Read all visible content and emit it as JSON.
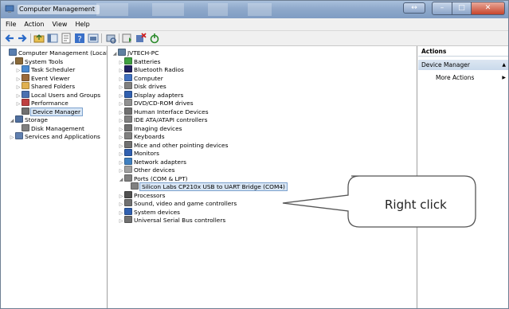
{
  "window": {
    "title": "Computer Management"
  },
  "menu": [
    "File",
    "Action",
    "View",
    "Help"
  ],
  "left_tree": [
    {
      "label": "Computer Management (Local",
      "indent": 0,
      "exp": "",
      "icon": "computer-management-icon",
      "color": "#5a7fb0"
    },
    {
      "label": "System Tools",
      "indent": 1,
      "exp": "◢",
      "icon": "tools-icon",
      "color": "#8a6a3a"
    },
    {
      "label": "Task Scheduler",
      "indent": 2,
      "exp": "▷",
      "icon": "clock-icon",
      "color": "#4a8ad0"
    },
    {
      "label": "Event Viewer",
      "indent": 2,
      "exp": "▷",
      "icon": "event-icon",
      "color": "#9a6a3a"
    },
    {
      "label": "Shared Folders",
      "indent": 2,
      "exp": "▷",
      "icon": "folder-icon",
      "color": "#e0b050"
    },
    {
      "label": "Local Users and Groups",
      "indent": 2,
      "exp": "▷",
      "icon": "users-icon",
      "color": "#4a70b0"
    },
    {
      "label": "Performance",
      "indent": 2,
      "exp": "▷",
      "icon": "performance-icon",
      "color": "#c04040"
    },
    {
      "label": "Device Manager",
      "indent": 2,
      "exp": "",
      "icon": "device-manager-icon",
      "color": "#707070",
      "selected": true
    },
    {
      "label": "Storage",
      "indent": 1,
      "exp": "◢",
      "icon": "storage-icon",
      "color": "#5070a0"
    },
    {
      "label": "Disk Management",
      "indent": 2,
      "exp": "",
      "icon": "disk-icon",
      "color": "#808080"
    },
    {
      "label": "Services and Applications",
      "indent": 1,
      "exp": "▷",
      "icon": "services-icon",
      "color": "#6080b0"
    }
  ],
  "device_tree": [
    {
      "label": "JVTECH-PC",
      "indent": 0,
      "exp": "◢",
      "icon": "pc-icon",
      "color": "#6080a0"
    },
    {
      "label": "Batteries",
      "indent": 1,
      "exp": "▷",
      "icon": "battery-icon",
      "color": "#40a040"
    },
    {
      "label": "Bluetooth Radios",
      "indent": 1,
      "exp": "▷",
      "icon": "bluetooth-icon",
      "color": "#202060"
    },
    {
      "label": "Computer",
      "indent": 1,
      "exp": "▷",
      "icon": "computer-icon",
      "color": "#4070c0"
    },
    {
      "label": "Disk drives",
      "indent": 1,
      "exp": "▷",
      "icon": "disk-drive-icon",
      "color": "#808080"
    },
    {
      "label": "Display adapters",
      "indent": 1,
      "exp": "▷",
      "icon": "display-icon",
      "color": "#3060b0"
    },
    {
      "label": "DVD/CD-ROM drives",
      "indent": 1,
      "exp": "▷",
      "icon": "dvd-icon",
      "color": "#909090"
    },
    {
      "label": "Human Interface Devices",
      "indent": 1,
      "exp": "▷",
      "icon": "hid-icon",
      "color": "#707070"
    },
    {
      "label": "IDE ATA/ATAPI controllers",
      "indent": 1,
      "exp": "▷",
      "icon": "ide-icon",
      "color": "#808080"
    },
    {
      "label": "Imaging devices",
      "indent": 1,
      "exp": "▷",
      "icon": "camera-icon",
      "color": "#707070"
    },
    {
      "label": "Keyboards",
      "indent": 1,
      "exp": "▷",
      "icon": "keyboard-icon",
      "color": "#808080"
    },
    {
      "label": "Mice and other pointing devices",
      "indent": 1,
      "exp": "▷",
      "icon": "mouse-icon",
      "color": "#707070"
    },
    {
      "label": "Monitors",
      "indent": 1,
      "exp": "▷",
      "icon": "monitor-icon",
      "color": "#3060b0"
    },
    {
      "label": "Network adapters",
      "indent": 1,
      "exp": "▷",
      "icon": "network-icon",
      "color": "#4080c0"
    },
    {
      "label": "Other devices",
      "indent": 1,
      "exp": "▷",
      "icon": "other-devices-icon",
      "color": "#a0a0a0"
    },
    {
      "label": "Ports (COM & LPT)",
      "indent": 1,
      "exp": "◢",
      "icon": "port-icon",
      "color": "#808080"
    },
    {
      "label": "Silicon Labs CP210x USB to UART Bridge (COM4)",
      "indent": 2,
      "exp": "",
      "icon": "port-device-icon",
      "color": "#808080",
      "selected": true
    },
    {
      "label": "Processors",
      "indent": 1,
      "exp": "▷",
      "icon": "processor-icon",
      "color": "#505050"
    },
    {
      "label": "Sound, video and game controllers",
      "indent": 1,
      "exp": "▷",
      "icon": "sound-icon",
      "color": "#707070"
    },
    {
      "label": "System devices",
      "indent": 1,
      "exp": "▷",
      "icon": "system-devices-icon",
      "color": "#3060b0"
    },
    {
      "label": "Universal Serial Bus controllers",
      "indent": 1,
      "exp": "▷",
      "icon": "usb-icon",
      "color": "#707070"
    }
  ],
  "actions": {
    "header": "Actions",
    "section": "Device Manager",
    "more": "More Actions"
  },
  "callout": {
    "text": "Right click"
  }
}
